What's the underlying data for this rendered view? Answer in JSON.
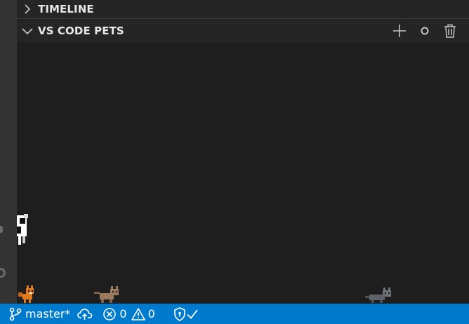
{
  "sections": {
    "timeline": {
      "title": "TIMELINE",
      "expanded": false
    },
    "pets": {
      "title": "VS CODE PETS",
      "expanded": true,
      "actions": [
        "add-pet",
        "throw-ball",
        "remove-pet"
      ]
    }
  },
  "pets": [
    {
      "name": "cow",
      "color": "#ffffff"
    },
    {
      "name": "orange-fox",
      "color": "#e07a1f"
    },
    {
      "name": "brown-cat",
      "color": "#9a7b5e"
    },
    {
      "name": "gray-cat",
      "color": "#6f7278"
    }
  ],
  "statusbar": {
    "branch": "master*",
    "errors": "0",
    "warnings": "0",
    "background": "#007acc"
  }
}
